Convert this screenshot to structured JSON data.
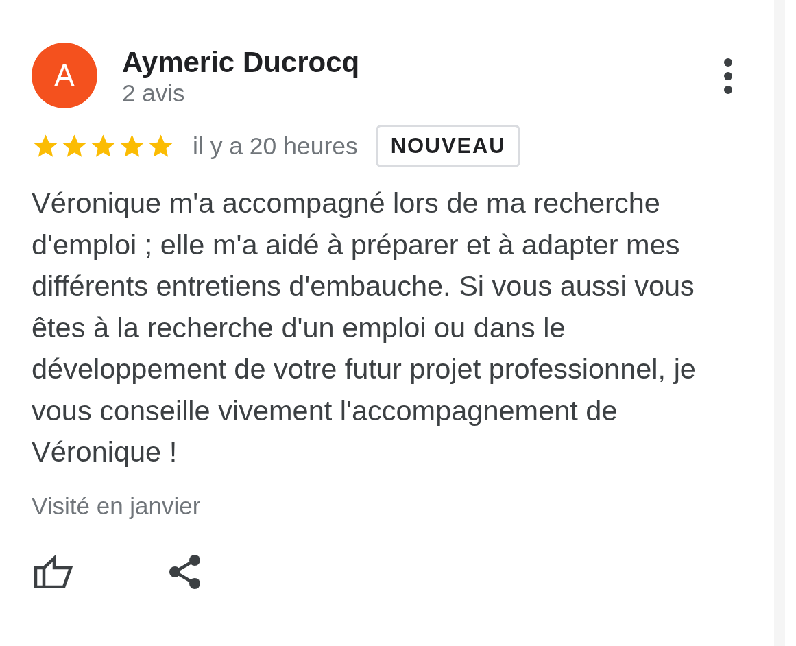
{
  "review": {
    "avatar_letter": "A",
    "author": "Aymeric Ducrocq",
    "review_count": "2 avis",
    "stars": 5,
    "time": "il y a 20 heures",
    "badge": "NOUVEAU",
    "text": "Véronique m'a accompagné lors de ma recherche d'emploi ; elle m'a aidé à préparer et à adapter mes différents entretiens d'embauche. Si vous aussi vous êtes à la recherche d'un emploi ou dans le développement de votre futur projet professionnel, je vous conseille vivement l'accompagnement de Véronique !",
    "visited": "Visité en janvier"
  }
}
